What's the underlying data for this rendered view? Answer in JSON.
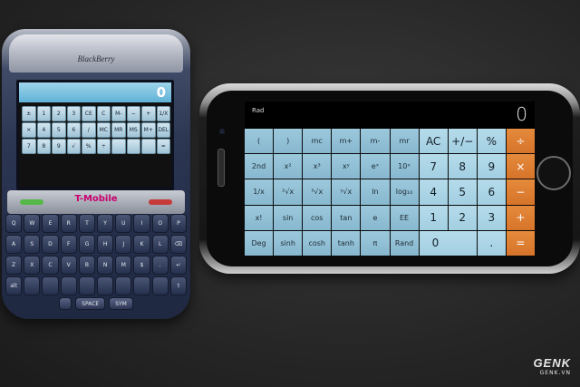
{
  "blackberry": {
    "brand": "BlackBerry",
    "carrier": "T-Mobile",
    "display": "0",
    "keys": [
      "±",
      "1",
      "2",
      "3",
      "CE",
      "C",
      "M-",
      "−",
      "+",
      "1/X",
      "×",
      "4",
      "5",
      "6",
      "/",
      "MC",
      "MR",
      "MS",
      "M+",
      "DEL",
      "7",
      "8",
      "9",
      "√",
      "%",
      "÷",
      "",
      "",
      "",
      "="
    ],
    "zero": "0",
    "keyboard": [
      "Q",
      "W",
      "E",
      "R",
      "T",
      "Y",
      "U",
      "I",
      "O",
      "P",
      "A",
      "S",
      "D",
      "F",
      "G",
      "H",
      "J",
      "K",
      "L",
      "⌫",
      "Z",
      "X",
      "C",
      "V",
      "B",
      "N",
      "M",
      "$",
      ".",
      "↵",
      "alt",
      "",
      "",
      "",
      "",
      "",
      "",
      "",
      "",
      "⇧"
    ],
    "bottom_keys": [
      "",
      "SPACE",
      "SYM"
    ]
  },
  "iphone": {
    "mode": "Rad",
    "result": "0",
    "keys": [
      {
        "l": "(",
        "t": "fn"
      },
      {
        "l": ")",
        "t": "fn"
      },
      {
        "l": "mc",
        "t": "fn"
      },
      {
        "l": "m+",
        "t": "fn"
      },
      {
        "l": "m-",
        "t": "fn"
      },
      {
        "l": "mr",
        "t": "fn"
      },
      {
        "l": "AC",
        "t": "num"
      },
      {
        "l": "+/−",
        "t": "num"
      },
      {
        "l": "%",
        "t": "num"
      },
      {
        "l": "÷",
        "t": "op"
      },
      {
        "l": "2nd",
        "t": "fn"
      },
      {
        "l": "x²",
        "t": "fn"
      },
      {
        "l": "x³",
        "t": "fn"
      },
      {
        "l": "xʸ",
        "t": "fn"
      },
      {
        "l": "eˣ",
        "t": "fn"
      },
      {
        "l": "10ˣ",
        "t": "fn"
      },
      {
        "l": "7",
        "t": "num"
      },
      {
        "l": "8",
        "t": "num"
      },
      {
        "l": "9",
        "t": "num"
      },
      {
        "l": "×",
        "t": "op"
      },
      {
        "l": "1/x",
        "t": "fn"
      },
      {
        "l": "²√x",
        "t": "fn"
      },
      {
        "l": "³√x",
        "t": "fn"
      },
      {
        "l": "ʸ√x",
        "t": "fn"
      },
      {
        "l": "ln",
        "t": "fn"
      },
      {
        "l": "log₁₀",
        "t": "fn"
      },
      {
        "l": "4",
        "t": "num"
      },
      {
        "l": "5",
        "t": "num"
      },
      {
        "l": "6",
        "t": "num"
      },
      {
        "l": "−",
        "t": "op"
      },
      {
        "l": "x!",
        "t": "fn"
      },
      {
        "l": "sin",
        "t": "fn"
      },
      {
        "l": "cos",
        "t": "fn"
      },
      {
        "l": "tan",
        "t": "fn"
      },
      {
        "l": "e",
        "t": "fn"
      },
      {
        "l": "EE",
        "t": "fn"
      },
      {
        "l": "1",
        "t": "num"
      },
      {
        "l": "2",
        "t": "num"
      },
      {
        "l": "3",
        "t": "num"
      },
      {
        "l": "+",
        "t": "op"
      },
      {
        "l": "Deg",
        "t": "fn"
      },
      {
        "l": "sinh",
        "t": "fn"
      },
      {
        "l": "cosh",
        "t": "fn"
      },
      {
        "l": "tanh",
        "t": "fn"
      },
      {
        "l": "π",
        "t": "fn"
      },
      {
        "l": "Rand",
        "t": "fn"
      },
      {
        "l": "0",
        "t": "zero"
      },
      {
        "l": ".",
        "t": "num"
      },
      {
        "l": "=",
        "t": "op"
      }
    ]
  },
  "watermark": {
    "logo": "GENK",
    "sub": "GENK.VN"
  }
}
